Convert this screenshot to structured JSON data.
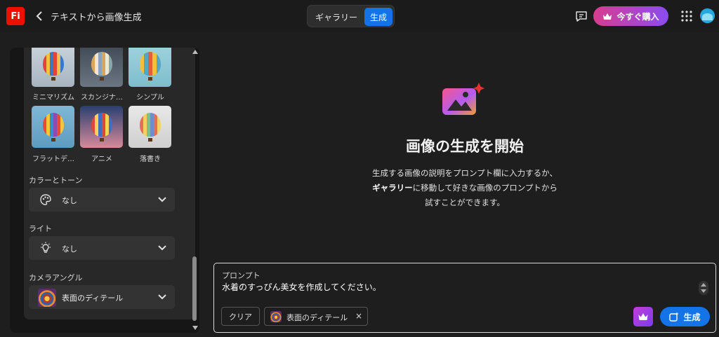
{
  "header": {
    "logo": "Fi",
    "title": "テキストから画像生成",
    "toggle": {
      "gallery": "ギャラリー",
      "generate": "生成",
      "active": "generate"
    },
    "buy_label": "今すぐ購入"
  },
  "sidebar": {
    "style_row1": [
      {
        "label": "ミニマリズム"
      },
      {
        "label": "スカンジナ…"
      },
      {
        "label": "シンプル"
      }
    ],
    "style_row2": [
      {
        "label": "フラットデ…"
      },
      {
        "label": "アニメ"
      },
      {
        "label": "落書き"
      }
    ],
    "color_tone": {
      "label": "カラーとトーン",
      "value": "なし"
    },
    "light": {
      "label": "ライト",
      "value": "なし"
    },
    "camera_angle": {
      "label": "カメラアングル",
      "value": "表面のディテール"
    }
  },
  "main": {
    "title": "画像の生成を開始",
    "desc_line1": "生成する画像の説明をプロンプト欄に入力するか、",
    "desc_line2_bold": "ギャラリー",
    "desc_line2_rest": "に移動して好きな画像のプロンプトから",
    "desc_line3": "試すことができます。"
  },
  "prompt": {
    "label": "プロンプト",
    "value": "水着のすっぴん美女を作成してください。",
    "clear_label": "クリア",
    "chip_label": "表面のディテール",
    "chip_close": "×",
    "generate_label": "生成"
  },
  "colors": {
    "accent": "#1473e6",
    "brand": "#eb1000",
    "buy_gradient_start": "#d83d8e",
    "buy_gradient_end": "#8a4cf2"
  }
}
